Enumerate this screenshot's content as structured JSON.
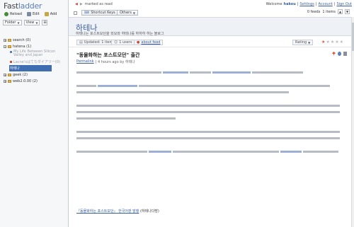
{
  "logo": {
    "part1": "Fast",
    "part2": "ladder"
  },
  "left_tools": [
    {
      "label": "Reload",
      "icon": "reload-icon",
      "color": "#4a8a3a"
    },
    {
      "label": "Edit",
      "icon": "edit-icon",
      "color": "#7a8aa0"
    },
    {
      "label": "Add",
      "icon": "add-icon",
      "color": "#c8a640"
    }
  ],
  "left_tools2": {
    "folder_label": "Folder",
    "view_label": "View"
  },
  "tree": [
    {
      "label": "search (0)",
      "type": "folder",
      "indent": 0
    },
    {
      "label": "hatena (1)",
      "type": "folder",
      "indent": 0
    },
    {
      "label": "My Life Between Silicon Valley and Japan",
      "type": "feed",
      "indent": 1
    },
    {
      "label": "Lacne'sはてなダイアリー(0)",
      "type": "feed",
      "indent": 1
    },
    {
      "label": "하테나",
      "type": "selected",
      "indent": 1
    },
    {
      "label": "geek (2)",
      "type": "folder",
      "indent": 0
    },
    {
      "label": "web2.0.00 (2)",
      "type": "folder",
      "indent": 0
    }
  ],
  "topbar": {
    "unread_text": "marked as read",
    "welcome": "Welcome",
    "user": "hakou",
    "links": [
      "Settings",
      "Account",
      "Sign Out"
    ]
  },
  "toolbar": {
    "shortcut_label": "Shortcut Keys",
    "others_label": "Others",
    "count_text": "0 feeds",
    "items_text": "1 items"
  },
  "feed": {
    "title": "하테나",
    "description": "하테나는 포스트모던을 외모와 하테나를 하하하 하는 블로그"
  },
  "subbar": {
    "updated": "Updated: 1 items",
    "users": "1 users",
    "about": "about feed",
    "rating_label": "Rating"
  },
  "item": {
    "title": "\"동물화하는 포스트모던\" 출간",
    "permalink": "Permalink",
    "meta": "| 4 hours ago by 하테나"
  },
  "footer_link": {
    "text": "『동물화하는 포스트모던』 한국어판 발행",
    "suffix": "(하테나다방)"
  }
}
